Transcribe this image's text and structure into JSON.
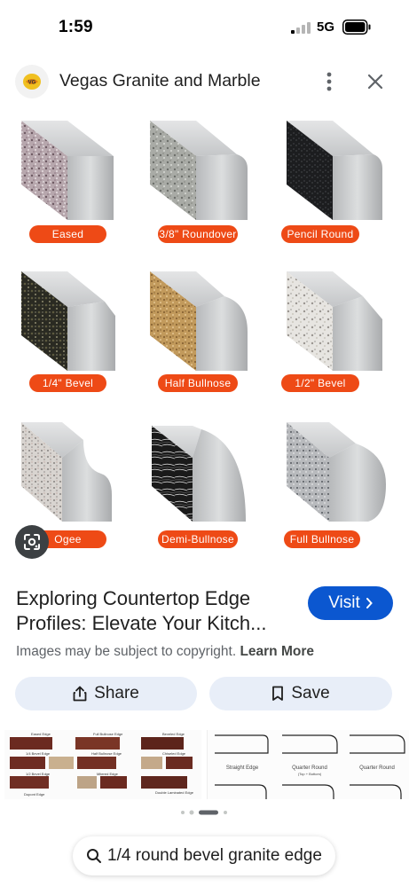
{
  "status_bar": {
    "time": "1:59",
    "network": "5G"
  },
  "header": {
    "site_name": "Vegas Granite and Marble",
    "favicon_icon": "vegas-granite-logo-icon",
    "more_icon": "more-vert-icon",
    "close_icon": "close-icon"
  },
  "image": {
    "profiles": [
      {
        "label": "Eased",
        "granite": "pink-grey-granite"
      },
      {
        "label": "3/8\" Roundover",
        "granite": "grey-granite"
      },
      {
        "label": "Pencil Round",
        "granite": "black-granite"
      },
      {
        "label": "1/4\" Bevel",
        "granite": "black-gold-granite"
      },
      {
        "label": "Half Bullnose",
        "granite": "tan-granite"
      },
      {
        "label": "1/2\" Bevel",
        "granite": "white-granite"
      },
      {
        "label": "Ogee",
        "granite": "light-speckled-granite"
      },
      {
        "label": "Demi-Bullnose",
        "granite": "black-marble"
      },
      {
        "label": "Full Bullnose",
        "granite": "salt-pepper-granite"
      }
    ],
    "pill_color": "#ee4a16"
  },
  "result": {
    "title": "Exploring Countertop Edge Profiles: Elevate Your Kitch...",
    "visit_label": "Visit",
    "copyright_text": "Images may be subject to copyright.",
    "learn_more": "Learn More",
    "share_label": "Share",
    "save_label": "Save"
  },
  "related": {
    "thumb1_labels": [
      "Eased Edge",
      "Full Bullnose Edge",
      "Beveled Edge",
      "1/4 Bevel Edge",
      "Half Bullnose Edge",
      "Chiseled Edge",
      "1/2 Bevel Edge",
      "Mitered Edge",
      "Double Laminated Edge",
      "Dupont Edge"
    ],
    "thumb2_labels": [
      "Straight Edge",
      "Quarter Round",
      "(Top + Bottom)",
      "Quarter Round"
    ]
  },
  "search": {
    "query": "1/4 round bevel granite edge",
    "icon": "search-icon"
  },
  "colors": {
    "accent": "#0b57d0",
    "chip_bg": "#e8eef8"
  }
}
